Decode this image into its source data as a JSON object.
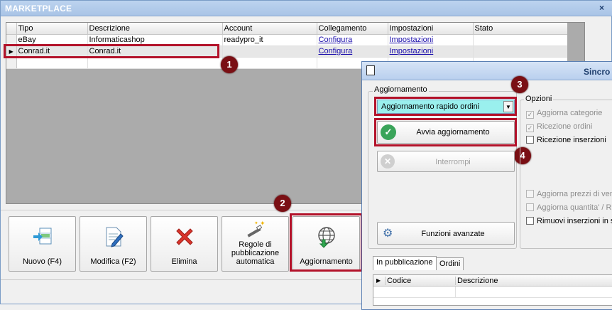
{
  "window": {
    "title": "MARKETPLACE",
    "close_glyph": "×"
  },
  "grid": {
    "columns": [
      "Tipo",
      "Descrizione",
      "Account",
      "Collegamento",
      "Impostazioni",
      "Stato"
    ],
    "rows": [
      {
        "tipo": "eBay",
        "descrizione": "Informaticashop",
        "account": "readypro_it",
        "collegamento": "Configura",
        "impostazioni": "Impostazioni",
        "stato": ""
      },
      {
        "tipo": "Conrad.it",
        "descrizione": "Conrad.it",
        "account": "",
        "collegamento": "Configura",
        "impostazioni": "Impostazioni",
        "stato": ""
      }
    ],
    "row_indicator_glyph": "▶"
  },
  "toolbar": {
    "nuovo": "Nuovo (F4)",
    "modifica": "Modifica (F2)",
    "elimina": "Elimina",
    "regole": "Regole di pubblicazione automatica",
    "aggiornamento": "Aggiornamento"
  },
  "badges": {
    "b1": "1",
    "b2": "2",
    "b3": "3",
    "b4": "4"
  },
  "dialog": {
    "title": "Sincro",
    "aggiornamento_group": "Aggiornamento",
    "combo_value": "Aggiornamento rapido ordini",
    "combo_arrow": "▼",
    "avvia_label": "Avvia aggiornamento",
    "interrompi_label": "Interrompi",
    "funzioni_label": "Funzioni avanzate",
    "opzioni_group": "Opzioni",
    "options": [
      {
        "label": "Aggiorna categorie",
        "checked": true,
        "enabled": false
      },
      {
        "label": "Ricezione ordini",
        "checked": true,
        "enabled": false
      },
      {
        "label": "Ricezione inserzioni",
        "checked": false,
        "enabled": true
      },
      {
        "label": "Aggiorna prezzi di ven",
        "checked": false,
        "enabled": false
      },
      {
        "label": "Aggiorna quantita' / R",
        "checked": false,
        "enabled": false
      },
      {
        "label": "Rimuovi inserzioni in st",
        "checked": false,
        "enabled": true
      }
    ],
    "check_glyph": "✓",
    "tabs": [
      "In pubblicazione",
      "Ordini"
    ],
    "subgrid_columns": [
      "Codice",
      "Descrizione"
    ]
  },
  "colors": {
    "highlight": "#b3122a",
    "badge": "#7a0f14",
    "combo_bg": "#9af0ee",
    "link": "#1a0dab"
  }
}
